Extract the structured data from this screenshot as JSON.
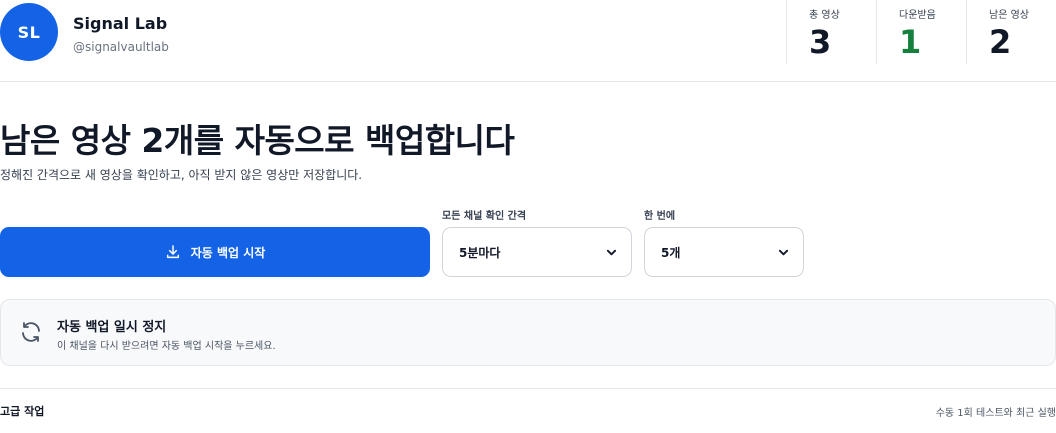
{
  "channel": {
    "initials": "SL",
    "name": "Signal Lab",
    "handle": "@signalvaultlab",
    "avatar_color": "#1463e6"
  },
  "stats": {
    "total": {
      "label": "총 영상",
      "value": "3",
      "color": "#111827"
    },
    "downloaded": {
      "label": "다운받음",
      "value": "1",
      "color": "#15803d"
    },
    "remaining": {
      "label": "남은 영상",
      "value": "2",
      "color": "#111827"
    }
  },
  "main": {
    "title": "남은 영상 2개를 자동으로 백업합니다",
    "subtitle": "정해진 간격으로 새 영상을 확인하고, 아직 받지 않은 영상만 저장합니다."
  },
  "controls": {
    "start_button": {
      "label": "자동 백업 시작",
      "icon": "download-icon"
    },
    "interval": {
      "label": "모든 채널 확인 간격",
      "value": "5분마다"
    },
    "batch": {
      "label": "한 번에",
      "value": "5개"
    }
  },
  "status": {
    "icon": "refresh-icon",
    "title": "자동 백업 일시 정지",
    "description": "이 채널을 다시 받으려면 자동 백업 시작을 누르세요."
  },
  "advanced": {
    "title": "고급 작업",
    "hint": "수동 1회 테스트와 최근 실행"
  },
  "colors": {
    "accent": "#1463e6",
    "success": "#15803d"
  }
}
